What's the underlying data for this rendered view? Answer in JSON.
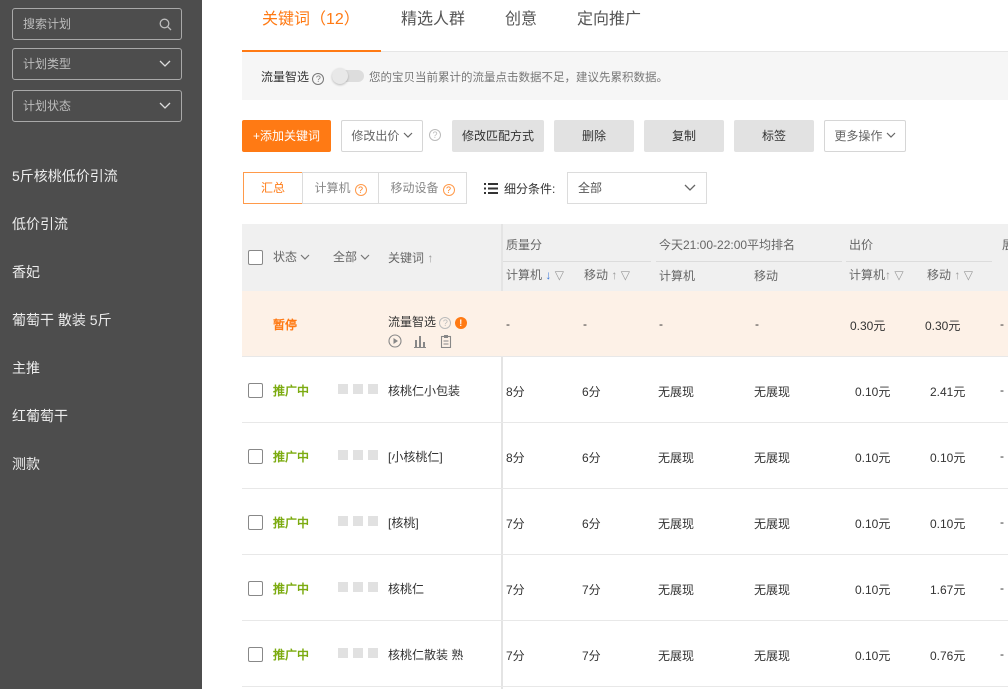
{
  "sidebar": {
    "search_placeholder": "搜索计划",
    "plan_type": "计划类型",
    "plan_status": "计划状态",
    "items": [
      "5斤核桃低价引流",
      "低价引流",
      "香妃",
      "葡萄干 散装 5斤",
      "主推",
      "红葡萄干",
      "测款"
    ]
  },
  "tabs": [
    "关键词（12）",
    "精选人群",
    "创意",
    "定向推广"
  ],
  "notice": {
    "label": "流量智选",
    "message": "您的宝贝当前累计的流量点击数据不足，建议先累积数据。"
  },
  "toolbar": {
    "add_keyword": "+添加关键词",
    "modify_bid": "修改出价",
    "modify_match": "修改匹配方式",
    "delete": "删除",
    "copy": "复制",
    "tag": "标签",
    "more_ops": "更多操作"
  },
  "view_tabs": [
    "汇总",
    "计算机",
    "移动设备"
  ],
  "filter": {
    "label": "细分条件:",
    "value": "全部"
  },
  "table": {
    "headers": {
      "status": "状态",
      "all": "全部",
      "keyword": "关键词",
      "quality": "质量分",
      "q_pc": "计算机",
      "q_mobile": "移动",
      "rank_group": "今天21:00-22:00平均排名",
      "r_pc": "计算机",
      "r_mobile": "移动",
      "bid_group": "出价",
      "b_pc": "计算机",
      "b_mobile": "移动",
      "cut": "展"
    },
    "smart_row": {
      "status": "暂停",
      "keyword": "流量智选",
      "q_pc": "-",
      "q_mobile": "-",
      "r_pc": "-",
      "r_mobile": "-",
      "b_pc": "0.30元",
      "b_mobile": "0.30元",
      "last": "-"
    },
    "rows": [
      {
        "status": "推广中",
        "keyword": "核桃仁小包装",
        "q_pc": "8分",
        "q_mobile": "6分",
        "r_pc": "无展现",
        "r_mobile": "无展现",
        "b_pc": "0.10元",
        "b_mobile": "2.41元",
        "last": "-"
      },
      {
        "status": "推广中",
        "keyword": "[小核桃仁]",
        "q_pc": "8分",
        "q_mobile": "6分",
        "r_pc": "无展现",
        "r_mobile": "无展现",
        "b_pc": "0.10元",
        "b_mobile": "0.10元",
        "last": "-"
      },
      {
        "status": "推广中",
        "keyword": "[核桃]",
        "q_pc": "7分",
        "q_mobile": "6分",
        "r_pc": "无展现",
        "r_mobile": "无展现",
        "b_pc": "0.10元",
        "b_mobile": "0.10元",
        "last": "-"
      },
      {
        "status": "推广中",
        "keyword": "核桃仁",
        "q_pc": "7分",
        "q_mobile": "7分",
        "r_pc": "无展现",
        "r_mobile": "无展现",
        "b_pc": "0.10元",
        "b_mobile": "1.67元",
        "last": "-"
      },
      {
        "status": "推广中",
        "keyword": "核桃仁散装 熟",
        "q_pc": "7分",
        "q_mobile": "7分",
        "r_pc": "无展现",
        "r_mobile": "无展现",
        "b_pc": "0.10元",
        "b_mobile": "0.76元",
        "last": "-"
      }
    ]
  },
  "colors": {
    "accent": "#ff7a14",
    "status_active": "#7cab11",
    "sidebar_bg": "#4d4d4d"
  }
}
